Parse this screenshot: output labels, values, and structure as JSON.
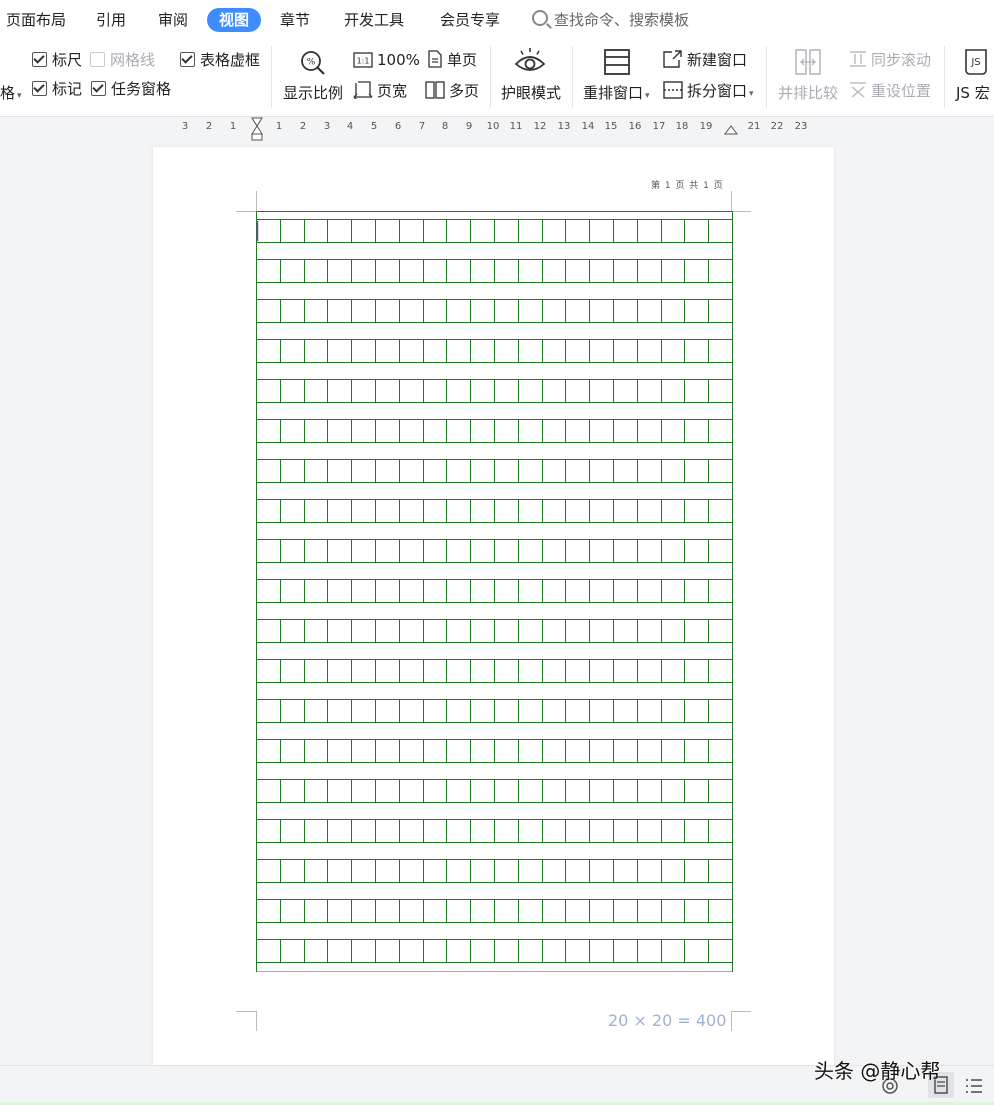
{
  "menu": {
    "tabs": [
      {
        "label": "页面布局"
      },
      {
        "label": "引用"
      },
      {
        "label": "审阅"
      },
      {
        "label": "视图"
      },
      {
        "label": "章节"
      },
      {
        "label": "开发工具"
      },
      {
        "label": "会员专享"
      }
    ],
    "active_tab": "视图",
    "search_placeholder": "查找命令、搜索模板",
    "accent_color": "#3f8cff"
  },
  "ribbon": {
    "cut_label": "格",
    "show_group": {
      "ruler": {
        "label": "标尺",
        "checked": true
      },
      "gridlines": {
        "label": "网格线",
        "checked": false
      },
      "table_gridlines": {
        "label": "表格虚框",
        "checked": true
      },
      "marks": {
        "label": "标记",
        "checked": true
      },
      "task_pane": {
        "label": "任务窗格",
        "checked": true
      }
    },
    "zoom_label": "显示比例",
    "zoom_100_label": "100%",
    "page_width_label": "页宽",
    "single_page_label": "单页",
    "multi_page_label": "多页",
    "eye_mode_label": "护眼模式",
    "arrange_windows_label": "重排窗口",
    "new_window_label": "新建窗口",
    "split_window_label": "拆分窗口",
    "side_by_side_label": "并排比较",
    "sync_scroll_label": "同步滚动",
    "reset_position_label": "重设位置",
    "js_macro_label": "JS 宏"
  },
  "ruler": {
    "left_ticks": [
      "3",
      "2",
      "1"
    ],
    "right_ticks": [
      "1",
      "2",
      "3",
      "4",
      "5",
      "6",
      "7",
      "8",
      "9",
      "10",
      "11",
      "12",
      "13",
      "14",
      "15",
      "16",
      "17",
      "18",
      "19",
      "21",
      "22",
      "23"
    ]
  },
  "document": {
    "header": "第 1 页 共 1 页",
    "grid_rows": 19,
    "grid_cols": 20,
    "grid_color": "#1e7a1e",
    "footer_count": "20  ×  20 = 400"
  },
  "status": {
    "watermark": "头条 @静心帮"
  }
}
